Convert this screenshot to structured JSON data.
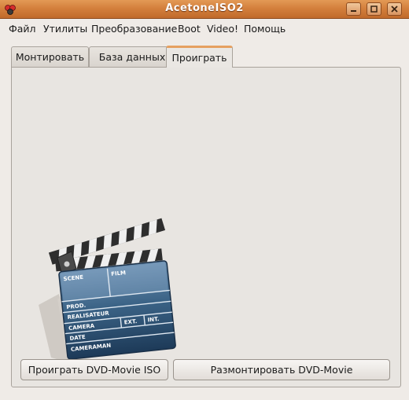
{
  "window": {
    "title": "AcetoneISO2"
  },
  "menu": [
    "Файл",
    "Утилиты",
    "Преобразование",
    "Boot",
    "Video!",
    "Помощь"
  ],
  "tabs": [
    "Монтировать",
    "База данных",
    "Проиграть"
  ],
  "active_tab": "Проиграть",
  "clapperboard_labels": {
    "scene": "SCENE",
    "film": "FILM",
    "prod": "PROD.",
    "realisateur": "REALISATEUR",
    "camera": "CAMERA",
    "ext": "EXT.",
    "int": "INT.",
    "date": "DATE",
    "cameraman": "CAMERAMAN"
  },
  "buttons": {
    "play_iso": "Проиграть DVD-Movie ISO",
    "unmount": "Размонтировать DVD-Movie"
  },
  "colors": {
    "titlebar": "#d4803d",
    "active_tab_accent": "#e6a060",
    "clapper_board": "#2f5577"
  }
}
